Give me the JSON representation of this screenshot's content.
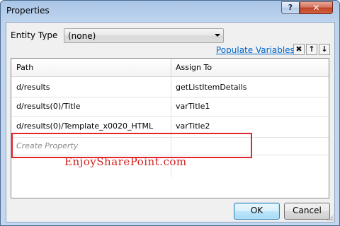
{
  "window": {
    "title": "Properties",
    "help_label": "?",
    "close_label": "✕"
  },
  "entity_type": {
    "label": "Entity Type",
    "selected": "(none)"
  },
  "toolbar": {
    "populate_link": "Populate Variables",
    "delete_label": "✖",
    "up_label": "↑",
    "down_label": "↓"
  },
  "grid": {
    "columns": [
      "Path",
      "Assign To"
    ],
    "rows": [
      {
        "path": "d/results",
        "assign": "getListItemDetails"
      },
      {
        "path": "d/results(0)/Title",
        "assign": "varTitle1"
      },
      {
        "path": "d/results(0)/Template_x0020_HTML",
        "assign": "varTitle2"
      }
    ],
    "create_placeholder": "Create Property"
  },
  "watermark": "EnjoySharePoint.com",
  "buttons": {
    "ok": "OK",
    "cancel": "Cancel"
  },
  "colors": {
    "highlight": "#e0282c",
    "link": "#0066cc",
    "watermark": "#d12020"
  }
}
